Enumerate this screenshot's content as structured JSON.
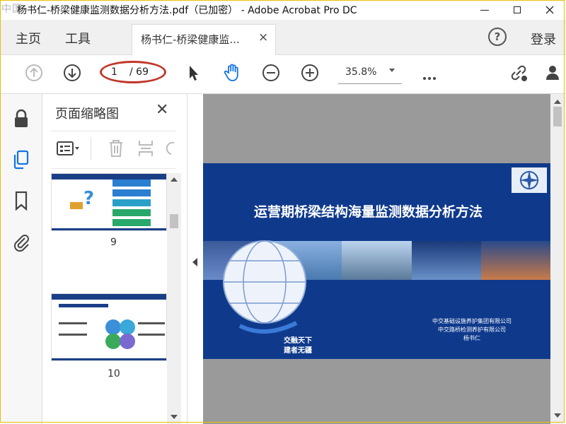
{
  "window": {
    "title": "杨书仁-桥梁健康监测数据分析方法.pdf（已加密） - Adobe Acrobat Pro DC",
    "watermark": "中国",
    "controls": [
      "minimize-icon",
      "maximize-icon",
      "close-icon"
    ]
  },
  "menubar": {
    "home": "主页",
    "tools": "工具",
    "document_tab": "杨书仁-桥梁健康监...",
    "tab_close": "×",
    "help": "?",
    "login": "登录"
  },
  "toolbar": {
    "current_page": "1",
    "total_pages": "/ 69",
    "zoom": "35.8%",
    "icons": [
      "previous-page-icon",
      "next-page-icon",
      "select-cursor-icon",
      "hand-tool-icon",
      "zoom-out-icon",
      "zoom-in-icon",
      "more-options-icon",
      "share-link-icon",
      "add-user-icon"
    ]
  },
  "sidebar": {
    "icons": [
      "lock-icon",
      "page-thumbnails-icon",
      "bookmark-icon",
      "attachment-icon"
    ],
    "panel_title": "页面缩略图",
    "close": "✕",
    "thumbnails": [
      {
        "page": "9"
      },
      {
        "page": "10"
      }
    ]
  },
  "document": {
    "slide_title": "运营期桥梁结构海量监测数据分析方法",
    "org_line1": "中交基础设施养护集团有限公司",
    "org_line2": "中交路桥检测养护有限公司",
    "author": "杨书仁",
    "slogan_line1": "交融天下",
    "slogan_line2": "建者无疆"
  },
  "colors": {
    "slide_blue": "#0f3a8c",
    "accent_blue": "#1473e6",
    "annotation_red": "#c0382b"
  }
}
